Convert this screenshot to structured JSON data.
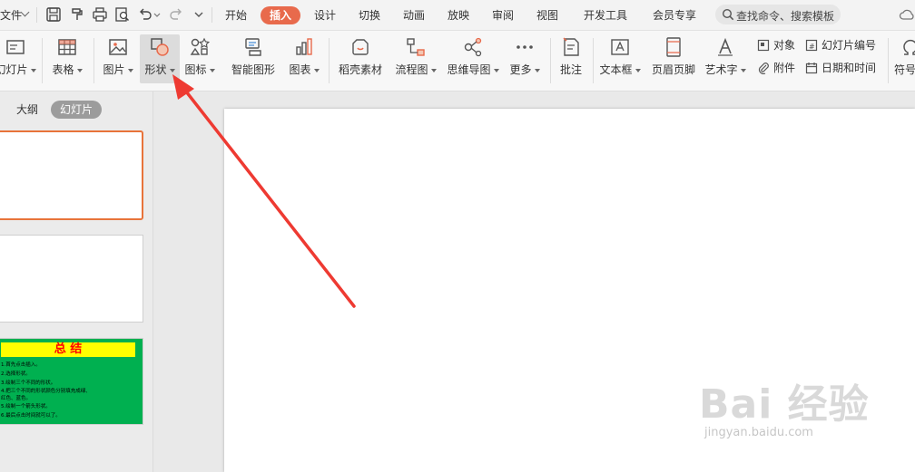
{
  "titlebar": {
    "file_label": "文件",
    "menu_tabs": [
      "开始",
      "插入",
      "设计",
      "切换",
      "动画",
      "放映",
      "审阅",
      "视图",
      "开发工具",
      "会员专享"
    ],
    "active_tab": "插入",
    "search_placeholder": "查找命令、搜索模板",
    "accent_color": "#e86a4c"
  },
  "ribbon": {
    "buttons": [
      "幻灯片",
      "表格",
      "图片",
      "形状",
      "图标",
      "智能图形",
      "图表",
      "稻壳素材",
      "流程图",
      "思维导图",
      "更多",
      "批注",
      "文本框",
      "页眉页脚",
      "艺术字",
      "符号"
    ],
    "selected_button": "形状",
    "small_buttons": [
      "对象",
      "幻灯片编号",
      "附件",
      "日期和时间"
    ]
  },
  "left_panel": {
    "tabs": [
      "大纲",
      "幻灯片"
    ],
    "active_tab": "幻灯片",
    "thumb3": {
      "title": "总 结",
      "lines": [
        "1.首先点击插入。",
        "2.选择形状。",
        "3.绘制三个不同的形状。",
        "4.把三个不同的形状颜色分别填充成绿、",
        "红色、蓝色。",
        "5.绘制一个箭头形状。",
        "6.最后点击时间就可以了。"
      ]
    }
  },
  "watermark": {
    "logo": "Bai 经验",
    "url": "jingyan.baidu.com"
  },
  "colors": {
    "selection_border": "#e8733a",
    "annotation_arrow": "#ee3a32",
    "thumb_green": "#00b050",
    "thumb_title_bg": "#ffff00",
    "thumb_title_fg": "#ff0000"
  }
}
